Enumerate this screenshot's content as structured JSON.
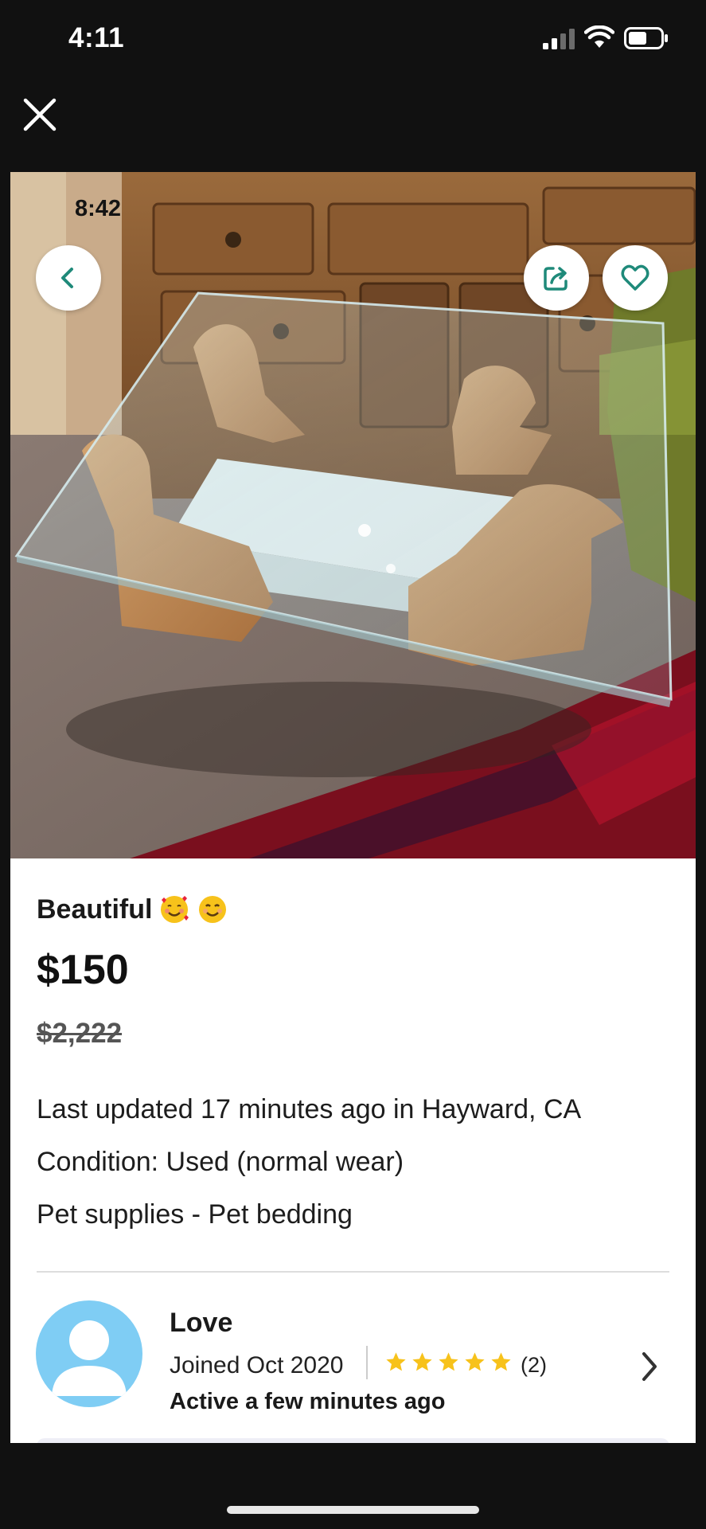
{
  "status_bar": {
    "time": "4:11",
    "icons": [
      "signal-icon",
      "wifi-icon",
      "battery-icon"
    ]
  },
  "top_bar": {
    "close_icon": "close-icon"
  },
  "listing": {
    "photo": {
      "inner_status_time": "8:42",
      "back_icon": "chevron-left-icon",
      "share_icon": "share-icon",
      "favorite_icon": "heart-icon"
    },
    "title": "Beautiful",
    "title_emojis": [
      "smiling-face-with-hearts-emoji",
      "smiling-face-emoji"
    ],
    "price": "$150",
    "original_price": "$2,222",
    "last_updated": "Last updated 17 minutes ago in Hayward, CA",
    "condition": "Condition: Used (normal wear)",
    "category": "Pet supplies - Pet bedding"
  },
  "seller": {
    "name": "Love",
    "joined": "Joined Oct 2020",
    "rating_stars": 5,
    "rating_count": "(2)",
    "active": "Active a few minutes ago"
  },
  "colors": {
    "accent": "#1f8a7a",
    "star": "#f7c21b",
    "avatar": "#7fcdf4",
    "background": "#111111"
  }
}
